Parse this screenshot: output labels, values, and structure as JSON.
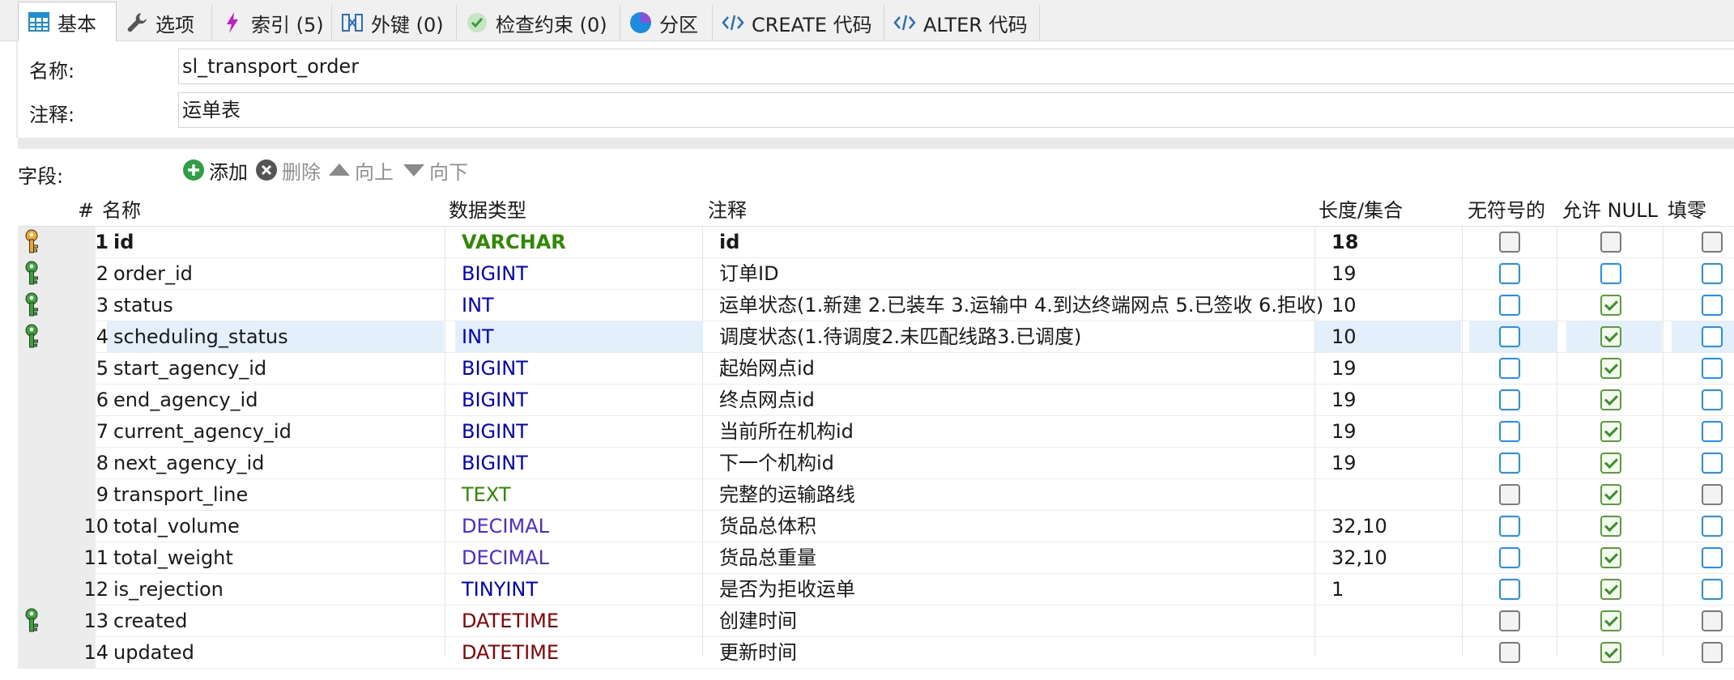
{
  "tabs": [
    {
      "label": "基本",
      "icon": "table-icon",
      "active": true
    },
    {
      "label": "选项",
      "icon": "wrench-icon"
    },
    {
      "label": "索引 (5)",
      "icon": "lightning-icon"
    },
    {
      "label": "外键 (0)",
      "icon": "foreign-key-icon"
    },
    {
      "label": "检查约束 (0)",
      "icon": "check-circle-icon"
    },
    {
      "label": "分区",
      "icon": "pie-icon"
    },
    {
      "label": "CREATE 代码",
      "icon": "code-icon"
    },
    {
      "label": "ALTER 代码",
      "icon": "code-icon"
    }
  ],
  "form": {
    "name_label": "名称:",
    "name_value": "sl_transport_order",
    "comment_label": "注释:",
    "comment_value": "运单表"
  },
  "toolbar": {
    "fields_label": "字段:",
    "add": "添加",
    "delete": "删除",
    "up": "向上",
    "down": "向下"
  },
  "columns": {
    "num": "#",
    "name": "名称",
    "type": "数据类型",
    "comment": "注释",
    "length": "长度/集合",
    "unsigned": "无符号的",
    "nullable": "允许 NULL",
    "zerofill": "填零"
  },
  "colors": {
    "varchar": "#2e8b00",
    "text": "#2e8b00",
    "int": "#0000c8",
    "decimal": "#4b2ae0",
    "datetime": "#8b0000",
    "pk_key": "#f5a623",
    "index_key": "#34a834"
  },
  "rows": [
    {
      "n": "1",
      "name": "id",
      "type": "VARCHAR",
      "tcolor": "varchar",
      "comment": "id",
      "length": "18",
      "key": "primary",
      "unsigned": "gray",
      "nullable": "gray",
      "zerofill": "gray",
      "bold": true
    },
    {
      "n": "2",
      "name": "order_id",
      "type": "BIGINT",
      "tcolor": "int",
      "comment": "订单ID",
      "length": "19",
      "key": "index",
      "unsigned": "blue",
      "nullable": "blue",
      "zerofill": "blue"
    },
    {
      "n": "3",
      "name": "status",
      "type": "INT",
      "tcolor": "int",
      "comment": "运单状态(1.新建 2.已装车 3.运输中 4.到达终端网点 5.已签收 6.拒收)",
      "length": "10",
      "key": "index",
      "unsigned": "blue",
      "nullable": "green",
      "zerofill": "blue"
    },
    {
      "n": "4",
      "name": "scheduling_status",
      "type": "INT",
      "tcolor": "int",
      "comment": "调度状态(1.待调度2.未匹配线路3.已调度)",
      "length": "10",
      "key": "index",
      "unsigned": "blue",
      "nullable": "green",
      "zerofill": "blue",
      "selected": true
    },
    {
      "n": "5",
      "name": "start_agency_id",
      "type": "BIGINT",
      "tcolor": "int",
      "comment": "起始网点id",
      "length": "19",
      "key": "",
      "unsigned": "blue",
      "nullable": "green",
      "zerofill": "blue"
    },
    {
      "n": "6",
      "name": "end_agency_id",
      "type": "BIGINT",
      "tcolor": "int",
      "comment": "终点网点id",
      "length": "19",
      "key": "",
      "unsigned": "blue",
      "nullable": "green",
      "zerofill": "blue"
    },
    {
      "n": "7",
      "name": "current_agency_id",
      "type": "BIGINT",
      "tcolor": "int",
      "comment": "当前所在机构id",
      "length": "19",
      "key": "",
      "unsigned": "blue",
      "nullable": "green",
      "zerofill": "blue"
    },
    {
      "n": "8",
      "name": "next_agency_id",
      "type": "BIGINT",
      "tcolor": "int",
      "comment": "下一个机构id",
      "length": "19",
      "key": "",
      "unsigned": "blue",
      "nullable": "green",
      "zerofill": "blue"
    },
    {
      "n": "9",
      "name": "transport_line",
      "type": "TEXT",
      "tcolor": "text",
      "comment": "完整的运输路线",
      "length": "",
      "key": "",
      "unsigned": "gray",
      "nullable": "green",
      "zerofill": "gray"
    },
    {
      "n": "10",
      "name": "total_volume",
      "type": "DECIMAL",
      "tcolor": "decimal",
      "comment": "货品总体积",
      "length": "32,10",
      "key": "",
      "unsigned": "blue",
      "nullable": "green",
      "zerofill": "blue"
    },
    {
      "n": "11",
      "name": "total_weight",
      "type": "DECIMAL",
      "tcolor": "decimal",
      "comment": "货品总重量",
      "length": "32,10",
      "key": "",
      "unsigned": "blue",
      "nullable": "green",
      "zerofill": "blue"
    },
    {
      "n": "12",
      "name": "is_rejection",
      "type": "TINYINT",
      "tcolor": "int",
      "comment": "是否为拒收运单",
      "length": "1",
      "key": "",
      "unsigned": "blue",
      "nullable": "green",
      "zerofill": "blue"
    },
    {
      "n": "13",
      "name": "created",
      "type": "DATETIME",
      "tcolor": "datetime",
      "comment": "创建时间",
      "length": "",
      "key": "index",
      "unsigned": "gray",
      "nullable": "green",
      "zerofill": "gray"
    },
    {
      "n": "14",
      "name": "updated",
      "type": "DATETIME",
      "tcolor": "datetime",
      "comment": "更新时间",
      "length": "",
      "key": "",
      "unsigned": "gray",
      "nullable": "green",
      "zerofill": "gray"
    }
  ]
}
